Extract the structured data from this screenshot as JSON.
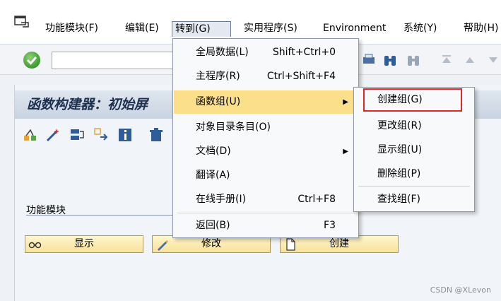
{
  "menubar": {
    "items": [
      {
        "label": "功能模块(F)"
      },
      {
        "label": "编辑(E)"
      },
      {
        "label": "转到(G)"
      },
      {
        "label": "实用程序(S)"
      },
      {
        "label": "Environment"
      },
      {
        "label": "系统(Y)"
      },
      {
        "label": "帮助(H)"
      }
    ]
  },
  "main": {
    "title": "函数构建器：初始屏",
    "field_label": "功能模块",
    "buttons": [
      {
        "label": "显示"
      },
      {
        "label": "修改"
      },
      {
        "label": "创建"
      }
    ]
  },
  "dropdown": {
    "items": [
      {
        "label": "全局数据(L)",
        "shortcut": "Shift+Ctrl+0"
      },
      {
        "label": "主程序(R)",
        "shortcut": "Ctrl+Shift+F4"
      },
      {
        "label": "函数组(U)",
        "shortcut": ""
      },
      {
        "label": "对象目录条目(O)",
        "shortcut": ""
      },
      {
        "label": "文档(D)",
        "shortcut": ""
      },
      {
        "label": "翻译(A)",
        "shortcut": ""
      },
      {
        "label": "在线手册(I)",
        "shortcut": "Ctrl+F8"
      },
      {
        "label": "返回(B)",
        "shortcut": "F3"
      }
    ]
  },
  "submenu": {
    "items": [
      {
        "label": "创建组(G)"
      },
      {
        "label": "更改组(R)"
      },
      {
        "label": "显示组(U)"
      },
      {
        "label": "删除组(P)"
      },
      {
        "label": "查找组(F)"
      }
    ]
  },
  "watermark": "CSDN @XLevon",
  "colors": {
    "highlight": "#fbdf8a",
    "selection_box": "#e0282c",
    "button_fill": "#f6e29a",
    "title_text": "#1d2f4f"
  }
}
